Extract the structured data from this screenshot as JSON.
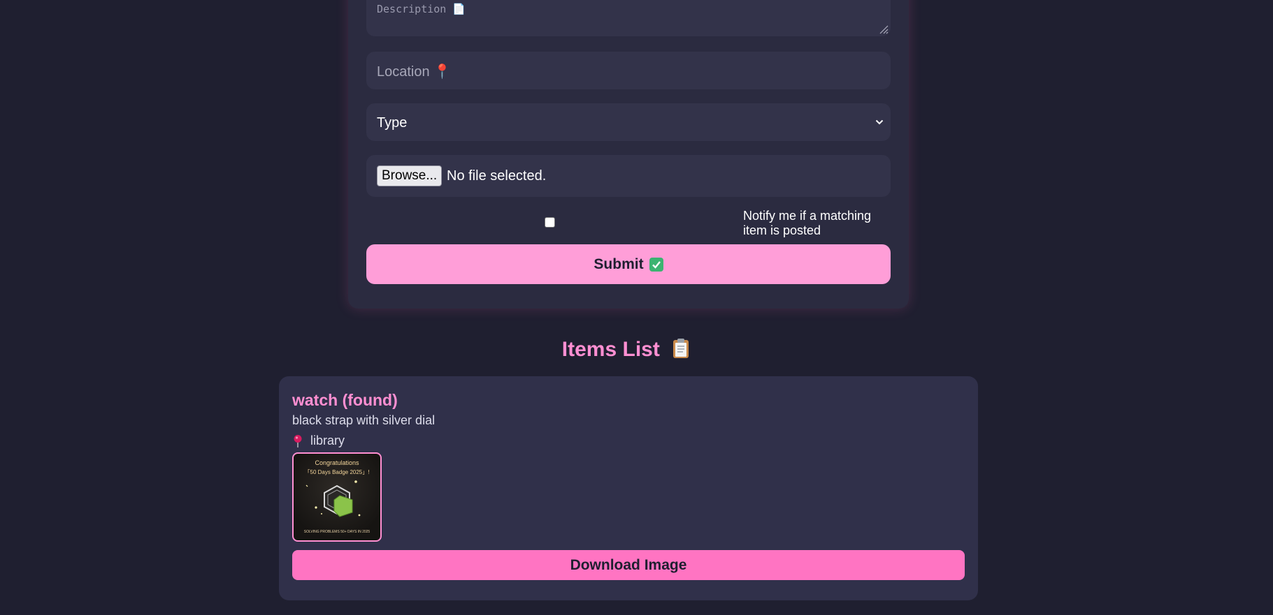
{
  "form": {
    "description_placeholder": "Description 📄",
    "location_placeholder": "Location 📍",
    "type_select_value": "Type",
    "file": {
      "browse_label": "Browse...",
      "status": "No file selected."
    },
    "notify_label": "Notify me if a matching item is posted",
    "notify_checked": false,
    "submit_label": "Submit"
  },
  "items_list": {
    "title": "Items List",
    "items": [
      {
        "title": "watch (found)",
        "description": "black strap with silver dial",
        "location": "library",
        "image": {
          "congrats": "Congratulations",
          "badge_name": "「50 Days Badge 2025」!",
          "footer": "SOLVING PROBLEMS 50+ DAYS IN 2025",
          "badge_year": "2025"
        },
        "download_label": "Download Image"
      }
    ]
  },
  "colors": {
    "background": "#1f1f30",
    "card": "#2b2b40",
    "accent_pink": "#ff8fd2",
    "submit_pink": "#ff9ed8",
    "download_pink": "#ff74c2"
  }
}
